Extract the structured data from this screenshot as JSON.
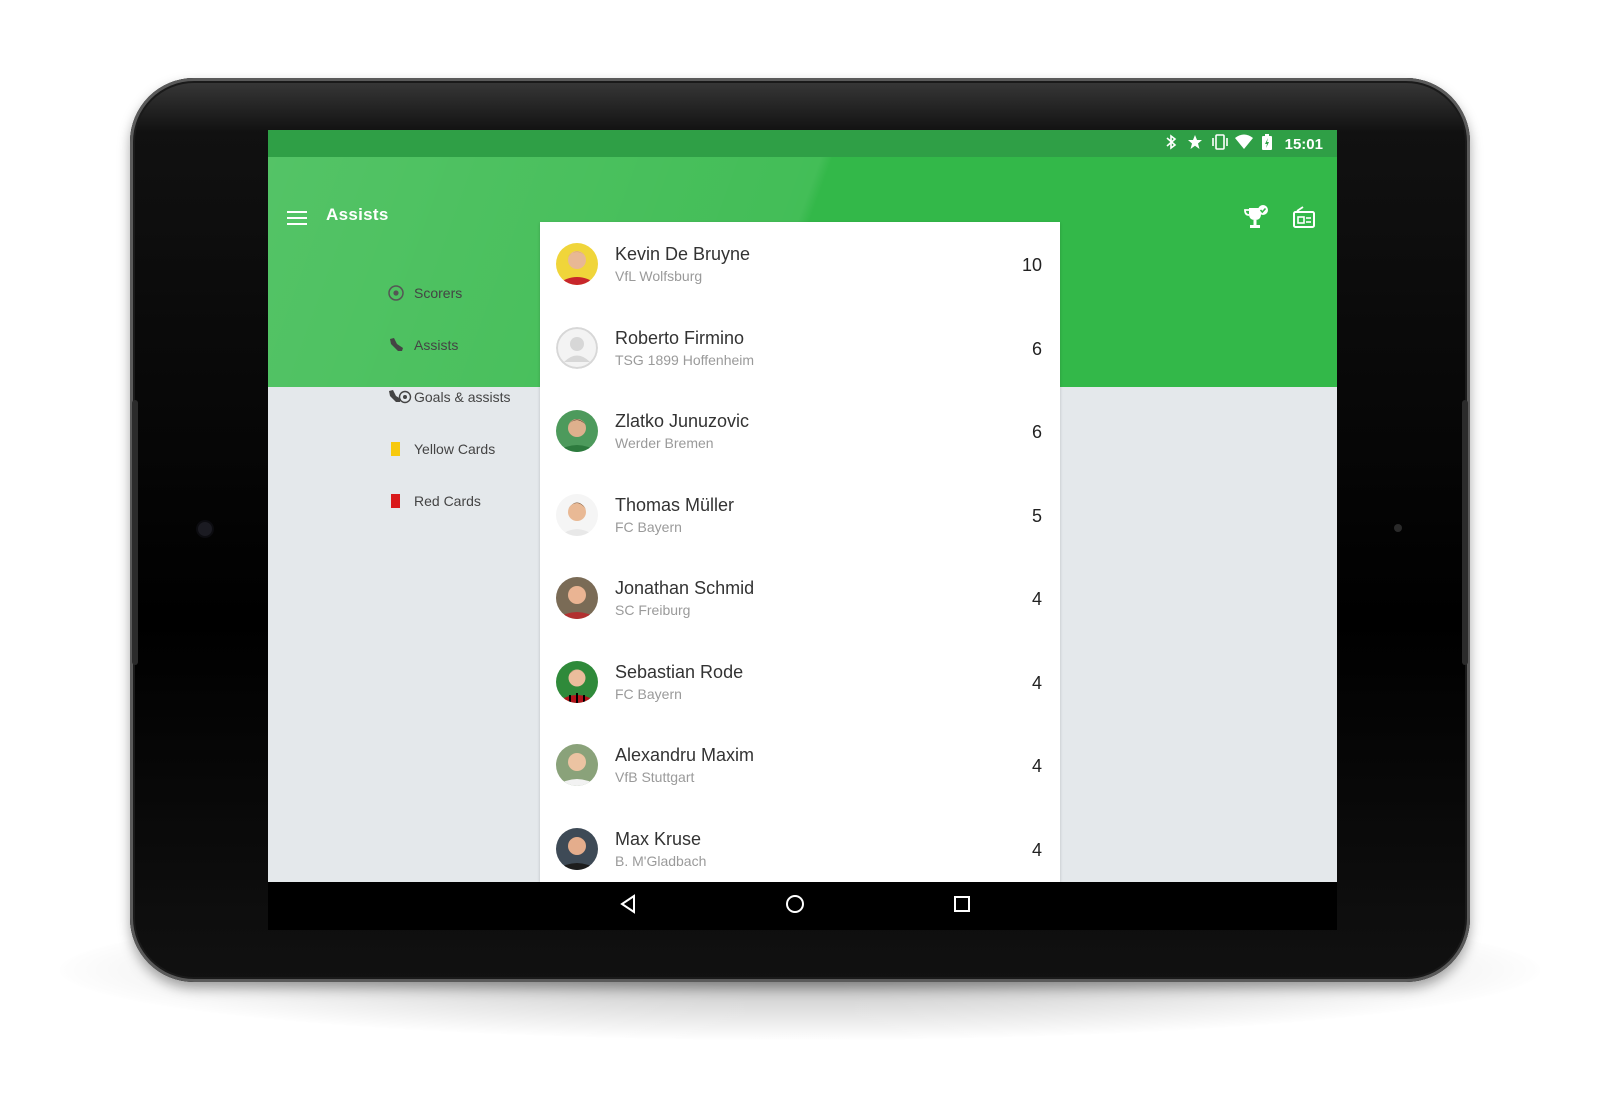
{
  "status_bar": {
    "time": "15:01",
    "icons": [
      "bluetooth-icon",
      "star-icon",
      "vibrate-icon",
      "wifi-icon",
      "battery-charging-icon"
    ]
  },
  "toolbar": {
    "title": "Assists",
    "menu_icon": "hamburger-menu-icon",
    "actions": [
      "trophy-check-icon",
      "news-icon"
    ],
    "color": "#33b849"
  },
  "nav": {
    "items": [
      {
        "label": "Scorers",
        "icon": "football-icon"
      },
      {
        "label": "Assists",
        "icon": "boot-icon"
      },
      {
        "label": "Goals & assists",
        "icon": "boot-ball-icon"
      },
      {
        "label": "Yellow Cards",
        "icon": "yellow-card-icon",
        "color": "#f7c90d"
      },
      {
        "label": "Red Cards",
        "icon": "red-card-icon",
        "color": "#d9191b"
      }
    ]
  },
  "players": [
    {
      "name": "Kevin De Bruyne",
      "team": "VfL Wolfsburg",
      "count": "10"
    },
    {
      "name": "Roberto Firmino",
      "team": "TSG 1899 Hoffenheim",
      "count": "6"
    },
    {
      "name": "Zlatko Junuzovic",
      "team": "Werder Bremen",
      "count": "6"
    },
    {
      "name": "Thomas Müller",
      "team": "FC Bayern",
      "count": "5"
    },
    {
      "name": "Jonathan Schmid",
      "team": "SC Freiburg",
      "count": "4"
    },
    {
      "name": "Sebastian Rode",
      "team": "FC Bayern",
      "count": "4"
    },
    {
      "name": "Alexandru Maxim",
      "team": "VfB Stuttgart",
      "count": "4"
    },
    {
      "name": "Max Kruse",
      "team": "B. M'Gladbach",
      "count": "4"
    }
  ],
  "system_nav": [
    "back-icon",
    "home-icon",
    "recents-icon"
  ]
}
